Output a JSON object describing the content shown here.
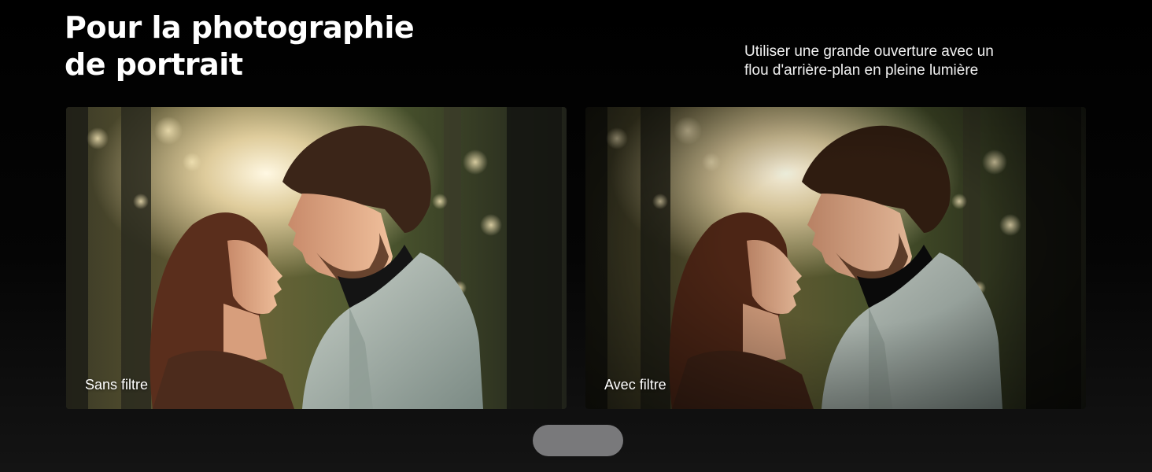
{
  "header": {
    "title_line1": "Pour la photographie",
    "title_line2": "de portrait",
    "subtitle_line1": "Utiliser une grande ouverture avec un",
    "subtitle_line2": "flou d'arrière-plan en pleine lumière"
  },
  "comparison": {
    "before_label": "Sans filtre",
    "after_label": "Avec filtre"
  },
  "colors": {
    "background": "#000000",
    "pager": "#79797b"
  }
}
